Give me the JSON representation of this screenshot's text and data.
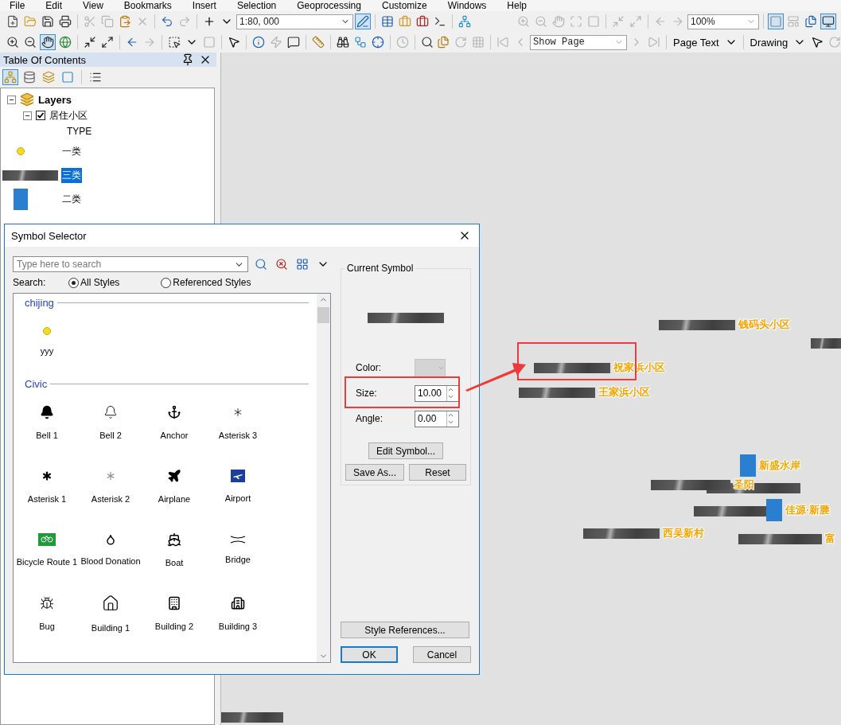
{
  "menu": [
    "File",
    "Edit",
    "View",
    "Bookmarks",
    "Insert",
    "Selection",
    "Geoprocessing",
    "Customize",
    "Windows",
    "Help"
  ],
  "toolbar": {
    "scale": "1:80, 000",
    "zoom": "100%",
    "page": "Show Page",
    "page_text_menu": "Page Text",
    "drawing_menu": "Drawing",
    "pan_selected": true
  },
  "toc": {
    "title": "Table Of Contents",
    "frame": {
      "name": "Layers",
      "expanded": true
    },
    "layer": {
      "name": "居住小区",
      "visible": true,
      "expanded": true,
      "field": "TYPE",
      "classes": [
        {
          "label": "一类",
          "kind": "dot",
          "selected": false
        },
        {
          "label": "三类",
          "kind": "texture",
          "selected": true
        },
        {
          "label": "二类",
          "kind": "photo",
          "selected": false
        }
      ]
    }
  },
  "dialog": {
    "title": "Symbol Selector",
    "search_placeholder": "Type here to search",
    "search_label": "Search:",
    "radios": [
      {
        "label": "All Styles",
        "selected": true
      },
      {
        "label": "Referenced Styles",
        "selected": false
      }
    ],
    "groups": [
      {
        "name": "chijing",
        "symbols": [
          {
            "label": "yyy",
            "kind": "dot"
          }
        ]
      },
      {
        "name": "Civic",
        "symbols": [
          {
            "label": "Bell 1",
            "kind": "bell-solid"
          },
          {
            "label": "Bell 2",
            "kind": "bell"
          },
          {
            "label": "Anchor",
            "kind": "anchor"
          },
          {
            "label": "Asterisk 3",
            "kind": "asterisk-thin"
          },
          {
            "label": "Asterisk 1",
            "kind": "asterisk"
          },
          {
            "label": "Asterisk 2",
            "kind": "asterisk-outline"
          },
          {
            "label": "Airplane",
            "kind": "plane"
          },
          {
            "label": "Airport",
            "kind": "airport"
          },
          {
            "label": "Bicycle Route 1",
            "kind": "bicycle"
          },
          {
            "label": "Blood Donation",
            "kind": "drop"
          },
          {
            "label": "Boat",
            "kind": "boat"
          },
          {
            "label": "Bridge",
            "kind": "bridge"
          },
          {
            "label": "Bug",
            "kind": "bug"
          },
          {
            "label": "Building 1",
            "kind": "house"
          },
          {
            "label": "Building 2",
            "kind": "tower"
          },
          {
            "label": "Building 3",
            "kind": "block"
          }
        ]
      }
    ],
    "current": {
      "title": "Current Symbol",
      "color_label": "Color:",
      "size_label": "Size:",
      "size": "10.00",
      "angle_label": "Angle:",
      "angle": "0.00"
    },
    "buttons": {
      "edit": "Edit Symbol...",
      "save_as": "Save As...",
      "reset": "Reset",
      "style_references": "Style References...",
      "ok": "OK",
      "cancel": "Cancel"
    }
  },
  "map": {
    "features": [
      {
        "label": "钱码头小区",
        "kind": "texture"
      },
      {
        "label": "祝家浜小区",
        "kind": "texture"
      },
      {
        "label": "王家浜小区",
        "kind": "texture"
      },
      {
        "label": "新盛水岸",
        "kind": "photo"
      },
      {
        "label": "圣阳",
        "kind": "texture"
      },
      {
        "label": "佳源·新塍",
        "kind": "photo"
      },
      {
        "label": "西吴新村",
        "kind": "texture"
      },
      {
        "label": "富",
        "kind": "texture"
      }
    ]
  }
}
